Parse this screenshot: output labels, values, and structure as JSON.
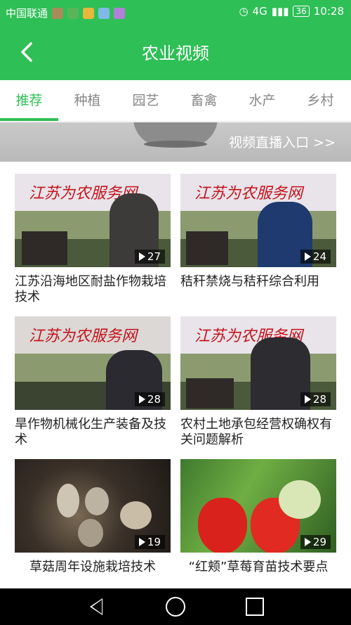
{
  "status": {
    "carrier": "中国联通",
    "network": "4G",
    "battery": "36",
    "time": "10:28"
  },
  "appbar": {
    "title": "农业视频"
  },
  "tabs": [
    "推荐",
    "种植",
    "园艺",
    "畜禽",
    "水产",
    "乡村"
  ],
  "banner": {
    "live_text": "视频直播入口 >>"
  },
  "videos": [
    {
      "title": "江苏沿海地区耐盐作物栽培技术",
      "views": "27"
    },
    {
      "title": "秸秆禁烧与秸秆综合利用",
      "views": "24"
    },
    {
      "title": "旱作物机械化生产装备及技术",
      "views": "28"
    },
    {
      "title": "农村土地承包经营权确权有关问题解析",
      "views": "28"
    },
    {
      "title": "草菇周年设施栽培技术",
      "views": "19"
    },
    {
      "title": "“红颊”草莓育苗技术要点",
      "views": "29"
    }
  ],
  "thumb_text": "江苏为农服务网",
  "colors": {
    "accent": "#2fbf57"
  }
}
